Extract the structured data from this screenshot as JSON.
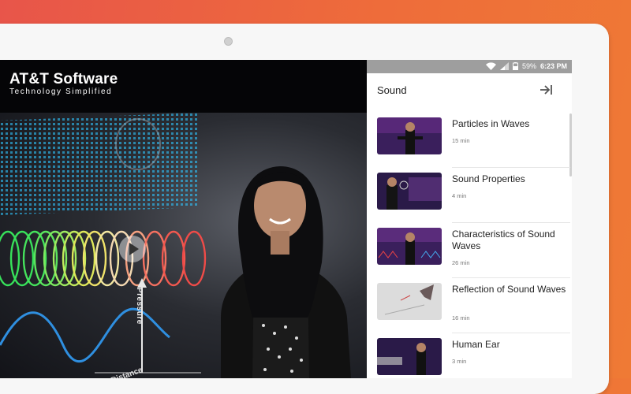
{
  "video": {
    "brand_name": "AT&T Software",
    "brand_tagline": "Technology Simplified",
    "axis_pressure": "Pressure",
    "axis_distance": "Distance"
  },
  "status": {
    "battery": "59%",
    "time": "6:23 PM"
  },
  "panel": {
    "title": "Sound",
    "items": [
      {
        "title": "Particles in Waves",
        "duration": "15 min"
      },
      {
        "title": "Sound Properties",
        "duration": "4 min"
      },
      {
        "title": "Characteristics of Sound Waves",
        "duration": "26 min"
      },
      {
        "title": "Reflection of Sound Waves",
        "duration": "16 min"
      },
      {
        "title": "Human Ear",
        "duration": "3 min"
      }
    ]
  },
  "icons": {
    "exit": "exit-icon",
    "play": "play-icon",
    "wifi": "wifi-icon",
    "signal": "signal-icon",
    "battery": "battery-icon"
  }
}
